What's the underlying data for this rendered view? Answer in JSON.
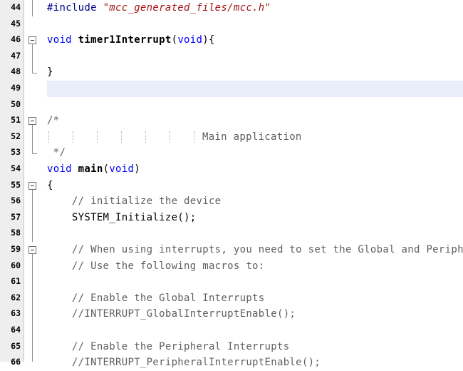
{
  "editor": {
    "current_line": "49",
    "lines": [
      {
        "num": "44",
        "code": "#include \"mcc_generated_files/mcc.h\""
      },
      {
        "num": "45",
        "code": ""
      },
      {
        "num": "46",
        "code": "void timer1Interrupt(void){"
      },
      {
        "num": "47",
        "code": ""
      },
      {
        "num": "48",
        "code": "}"
      },
      {
        "num": "49",
        "code": ""
      },
      {
        "num": "50",
        "code": ""
      },
      {
        "num": "51",
        "code": "/*"
      },
      {
        "num": "52",
        "code": "Main application"
      },
      {
        "num": "53",
        "code": " */"
      },
      {
        "num": "54",
        "code": "void main(void)"
      },
      {
        "num": "55",
        "code": "{"
      },
      {
        "num": "56",
        "code": "    // initialize the device"
      },
      {
        "num": "57",
        "code": "    SYSTEM_Initialize();"
      },
      {
        "num": "58",
        "code": ""
      },
      {
        "num": "59",
        "code": "    // When using interrupts, you need to set the Global and Periph"
      },
      {
        "num": "60",
        "code": "    // Use the following macros to:"
      },
      {
        "num": "61",
        "code": ""
      },
      {
        "num": "62",
        "code": "    // Enable the Global Interrupts"
      },
      {
        "num": "63",
        "code": "    //INTERRUPT_GlobalInterruptEnable();"
      },
      {
        "num": "64",
        "code": ""
      },
      {
        "num": "65",
        "code": "    // Enable the Peripheral Interrupts"
      },
      {
        "num": "66",
        "code": "    //INTERRUPT_PeripheralInterruptEnable();"
      }
    ]
  },
  "colors": {
    "gutter": "#eeeeee",
    "current_line_highlight": "#e8eef9",
    "keyword": "#0000ff",
    "comment": "#606060",
    "string": "#a31515"
  }
}
